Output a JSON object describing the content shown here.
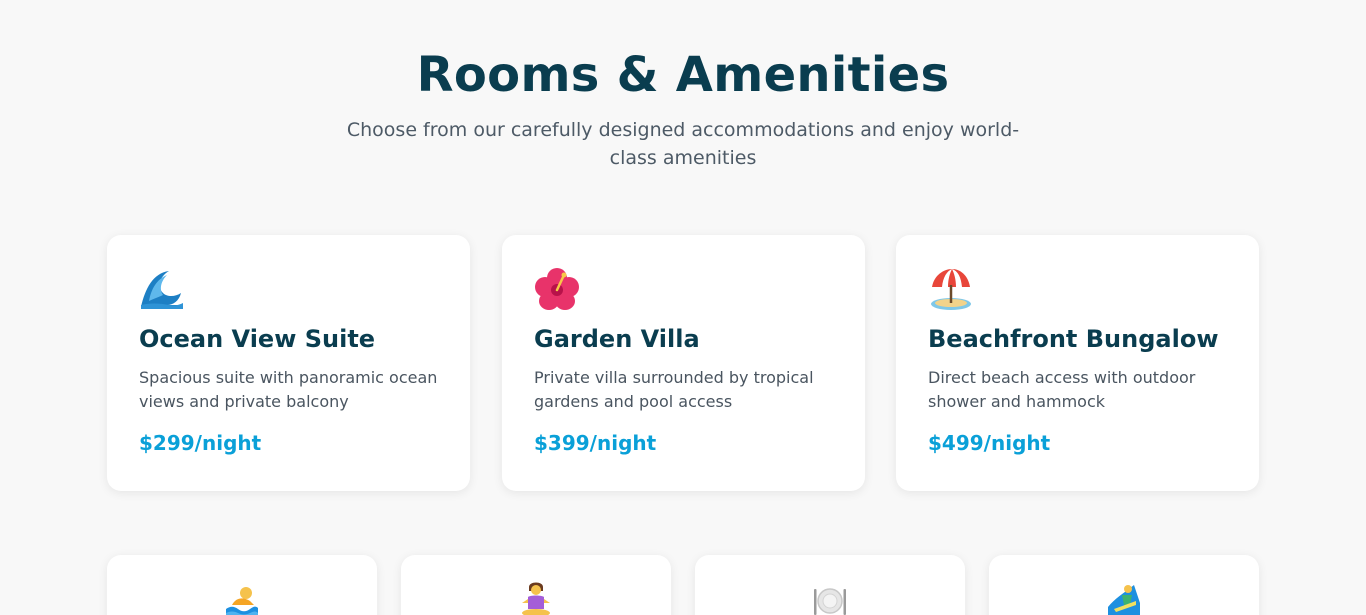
{
  "header": {
    "title": "Rooms & Amenities",
    "subtitle": "Choose from our carefully designed accommodations and enjoy world-class amenities"
  },
  "rooms": [
    {
      "icon": "ocean-wave-icon",
      "name": "Ocean View Suite",
      "description": "Spacious suite with panoramic ocean views and private balcony",
      "price": "$299/night"
    },
    {
      "icon": "hibiscus-flower-icon",
      "name": "Garden Villa",
      "description": "Private villa surrounded by tropical gardens and pool access",
      "price": "$399/night"
    },
    {
      "icon": "beach-umbrella-icon",
      "name": "Beachfront Bungalow",
      "description": "Direct beach access with outdoor shower and hammock",
      "price": "$499/night"
    }
  ],
  "amenities": [
    {
      "icon": "swimmer-icon"
    },
    {
      "icon": "yoga-icon"
    },
    {
      "icon": "dining-plate-icon"
    },
    {
      "icon": "surfer-icon"
    }
  ],
  "colors": {
    "heading": "#0a3d4f",
    "price": "#0aa0d8",
    "background": "#f8f8f8"
  }
}
